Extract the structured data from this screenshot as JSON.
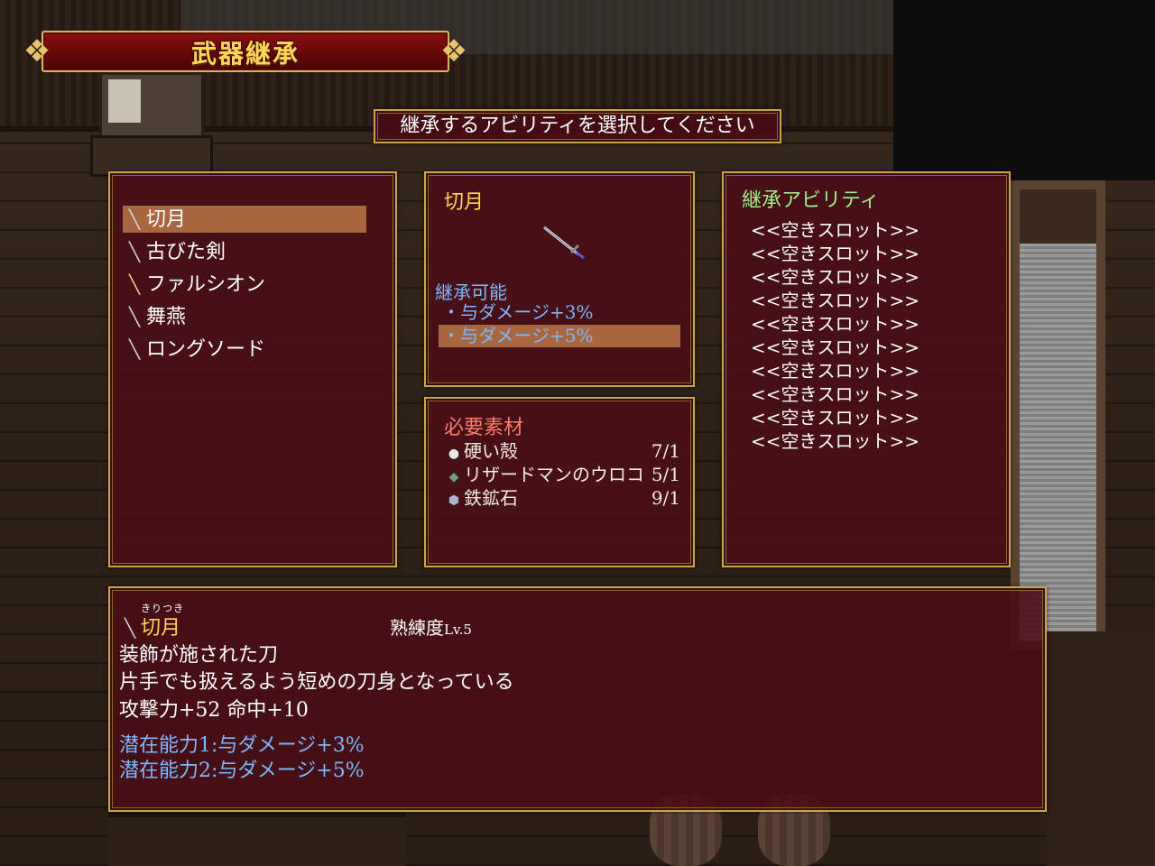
{
  "title": "武器継承",
  "prompt": "継承するアビリティを選択してください",
  "weapons": [
    {
      "name": "切月",
      "icon": "katana-icon"
    },
    {
      "name": "古びた剣",
      "icon": "sword-icon"
    },
    {
      "name": "ファルシオン",
      "icon": "falchion-icon"
    },
    {
      "name": "舞燕",
      "icon": "katana-icon"
    },
    {
      "name": "ロングソード",
      "icon": "sword-icon"
    }
  ],
  "detail": {
    "name": "切月",
    "inheritable_label": "継承可能",
    "options": [
      "・与ダメージ+3%",
      "・与ダメージ+5%"
    ]
  },
  "materials": {
    "label": "必要素材",
    "items": [
      {
        "name": "硬い殻",
        "count": "7/1",
        "icon": "shell-icon"
      },
      {
        "name": "リザードマンのウロコ",
        "count": "5/1",
        "icon": "scale-icon"
      },
      {
        "name": "鉄鉱石",
        "count": "9/1",
        "icon": "ore-icon"
      }
    ]
  },
  "abilities": {
    "label": "継承アビリティ",
    "slots": [
      "<<空きスロット>>",
      "<<空きスロット>>",
      "<<空きスロット>>",
      "<<空きスロット>>",
      "<<空きスロット>>",
      "<<空きスロット>>",
      "<<空きスロット>>",
      "<<空きスロット>>",
      "<<空きスロット>>",
      "<<空きスロット>>"
    ]
  },
  "info": {
    "ruby": "きりつき",
    "name": "切月",
    "proficiency_label": "熟練度",
    "proficiency_level": "Lv.5",
    "desc1": "装飾が施された刀",
    "desc2": "片手でも扱えるよう短めの刀身となっている",
    "stats": "攻撃力+52 命中+10",
    "potential1": "潜在能力1:与ダメージ+3%",
    "potential2": "潜在能力2:与ダメージ+5%"
  },
  "colors": {
    "window_bg": "#4a0e16",
    "border": "#c9a64a",
    "highlight": "#a8673e",
    "gold_text": "#ffd65a",
    "blue_text": "#7cb8ff",
    "green_text": "#9ff08a",
    "red_text": "#ff7a6a"
  }
}
